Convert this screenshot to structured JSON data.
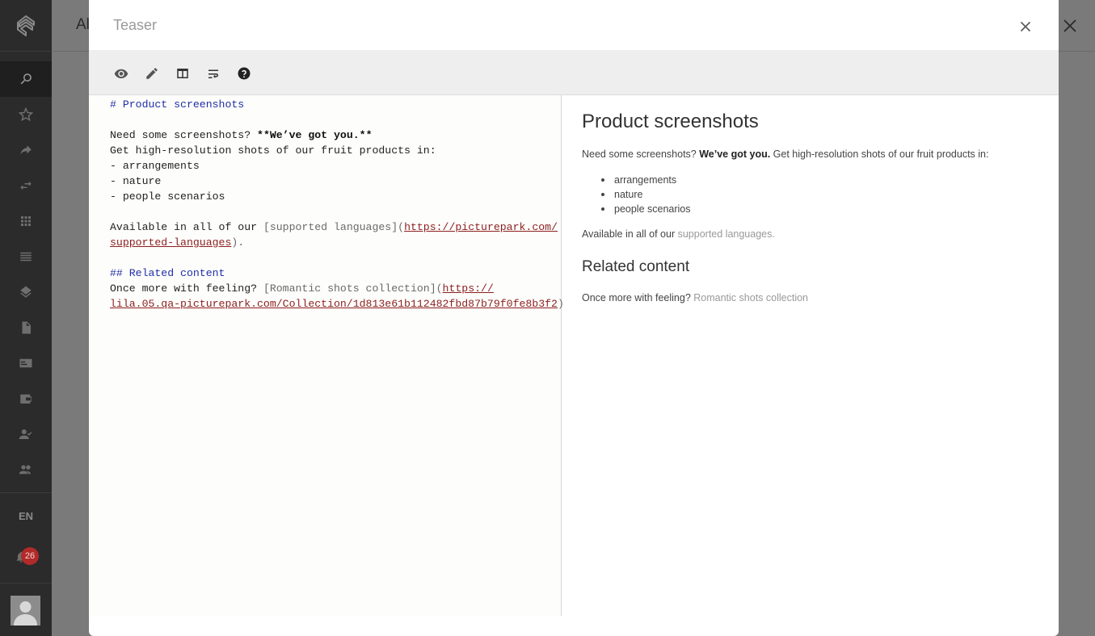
{
  "background": {
    "title_fragment": "Al"
  },
  "sidebar": {
    "items": [
      {
        "name": "search-icon"
      },
      {
        "name": "star-icon"
      },
      {
        "name": "share-icon"
      },
      {
        "name": "swap-icon"
      },
      {
        "name": "grid-icon"
      },
      {
        "name": "list-icon"
      },
      {
        "name": "layers-icon"
      },
      {
        "name": "document-icon"
      },
      {
        "name": "card-icon"
      },
      {
        "name": "wallet-icon"
      },
      {
        "name": "user-check-icon"
      },
      {
        "name": "users-icon"
      }
    ],
    "language": "EN",
    "notification_count": "26"
  },
  "modal": {
    "title": "Teaser",
    "toolbar": [
      {
        "name": "preview-icon"
      },
      {
        "name": "edit-icon"
      },
      {
        "name": "split-view-icon"
      },
      {
        "name": "wrap-text-icon"
      },
      {
        "name": "help-icon"
      }
    ]
  },
  "editor": {
    "line1": "# Product screenshots",
    "line3a": "Need some screenshots? ",
    "line3b": "**We’ve got you.**",
    "line4": "Get high-resolution shots of our fruit products in:",
    "line5": "- arrangements",
    "line6": "- nature",
    "line7": "- people scenarios",
    "line9a": "Available in all of our ",
    "line9b": "[supported languages]",
    "line9c": "(",
    "line9d": "https://picturepark.com/",
    "line10a": "supported-languages",
    "line10b": ").",
    "line12": "## Related content",
    "line13a": "Once more with feeling? ",
    "line13b": "[Romantic shots collection]",
    "line13c": "(",
    "line13d": "https://",
    "line14a": "lila.05.qa-picturepark.com/Collection/1d813e61b112482fbd87b79f0fe8b3f2",
    "line14b": ")"
  },
  "preview": {
    "h1": "Product screenshots",
    "p1a": "Need some screenshots? ",
    "p1b": "We’ve got you.",
    "p1c": " Get high-resolution shots of our fruit products in:",
    "list": [
      "arrangements",
      "nature",
      "people scenarios"
    ],
    "p2a": "Available in all of our ",
    "p2link": "supported languages",
    "p2b": ".",
    "h2": "Related content",
    "p3a": "Once more with feeling? ",
    "p3link": "Romantic shots collection"
  }
}
